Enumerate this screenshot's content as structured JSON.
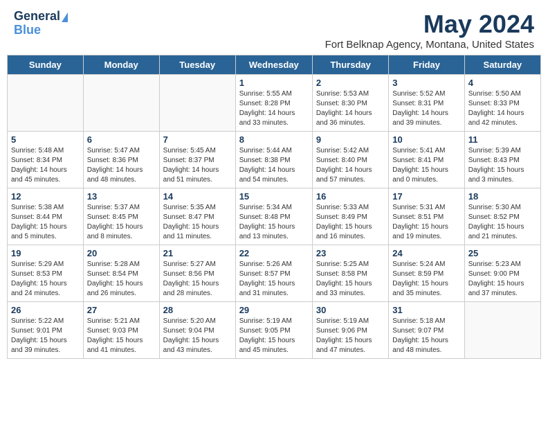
{
  "header": {
    "logo_line1": "General",
    "logo_line2": "Blue",
    "month_title": "May 2024",
    "subtitle": "Fort Belknap Agency, Montana, United States"
  },
  "weekdays": [
    "Sunday",
    "Monday",
    "Tuesday",
    "Wednesday",
    "Thursday",
    "Friday",
    "Saturday"
  ],
  "weeks": [
    [
      {
        "day": "",
        "info": ""
      },
      {
        "day": "",
        "info": ""
      },
      {
        "day": "",
        "info": ""
      },
      {
        "day": "1",
        "info": "Sunrise: 5:55 AM\nSunset: 8:28 PM\nDaylight: 14 hours\nand 33 minutes."
      },
      {
        "day": "2",
        "info": "Sunrise: 5:53 AM\nSunset: 8:30 PM\nDaylight: 14 hours\nand 36 minutes."
      },
      {
        "day": "3",
        "info": "Sunrise: 5:52 AM\nSunset: 8:31 PM\nDaylight: 14 hours\nand 39 minutes."
      },
      {
        "day": "4",
        "info": "Sunrise: 5:50 AM\nSunset: 8:33 PM\nDaylight: 14 hours\nand 42 minutes."
      }
    ],
    [
      {
        "day": "5",
        "info": "Sunrise: 5:48 AM\nSunset: 8:34 PM\nDaylight: 14 hours\nand 45 minutes."
      },
      {
        "day": "6",
        "info": "Sunrise: 5:47 AM\nSunset: 8:36 PM\nDaylight: 14 hours\nand 48 minutes."
      },
      {
        "day": "7",
        "info": "Sunrise: 5:45 AM\nSunset: 8:37 PM\nDaylight: 14 hours\nand 51 minutes."
      },
      {
        "day": "8",
        "info": "Sunrise: 5:44 AM\nSunset: 8:38 PM\nDaylight: 14 hours\nand 54 minutes."
      },
      {
        "day": "9",
        "info": "Sunrise: 5:42 AM\nSunset: 8:40 PM\nDaylight: 14 hours\nand 57 minutes."
      },
      {
        "day": "10",
        "info": "Sunrise: 5:41 AM\nSunset: 8:41 PM\nDaylight: 15 hours\nand 0 minutes."
      },
      {
        "day": "11",
        "info": "Sunrise: 5:39 AM\nSunset: 8:43 PM\nDaylight: 15 hours\nand 3 minutes."
      }
    ],
    [
      {
        "day": "12",
        "info": "Sunrise: 5:38 AM\nSunset: 8:44 PM\nDaylight: 15 hours\nand 5 minutes."
      },
      {
        "day": "13",
        "info": "Sunrise: 5:37 AM\nSunset: 8:45 PM\nDaylight: 15 hours\nand 8 minutes."
      },
      {
        "day": "14",
        "info": "Sunrise: 5:35 AM\nSunset: 8:47 PM\nDaylight: 15 hours\nand 11 minutes."
      },
      {
        "day": "15",
        "info": "Sunrise: 5:34 AM\nSunset: 8:48 PM\nDaylight: 15 hours\nand 13 minutes."
      },
      {
        "day": "16",
        "info": "Sunrise: 5:33 AM\nSunset: 8:49 PM\nDaylight: 15 hours\nand 16 minutes."
      },
      {
        "day": "17",
        "info": "Sunrise: 5:31 AM\nSunset: 8:51 PM\nDaylight: 15 hours\nand 19 minutes."
      },
      {
        "day": "18",
        "info": "Sunrise: 5:30 AM\nSunset: 8:52 PM\nDaylight: 15 hours\nand 21 minutes."
      }
    ],
    [
      {
        "day": "19",
        "info": "Sunrise: 5:29 AM\nSunset: 8:53 PM\nDaylight: 15 hours\nand 24 minutes."
      },
      {
        "day": "20",
        "info": "Sunrise: 5:28 AM\nSunset: 8:54 PM\nDaylight: 15 hours\nand 26 minutes."
      },
      {
        "day": "21",
        "info": "Sunrise: 5:27 AM\nSunset: 8:56 PM\nDaylight: 15 hours\nand 28 minutes."
      },
      {
        "day": "22",
        "info": "Sunrise: 5:26 AM\nSunset: 8:57 PM\nDaylight: 15 hours\nand 31 minutes."
      },
      {
        "day": "23",
        "info": "Sunrise: 5:25 AM\nSunset: 8:58 PM\nDaylight: 15 hours\nand 33 minutes."
      },
      {
        "day": "24",
        "info": "Sunrise: 5:24 AM\nSunset: 8:59 PM\nDaylight: 15 hours\nand 35 minutes."
      },
      {
        "day": "25",
        "info": "Sunrise: 5:23 AM\nSunset: 9:00 PM\nDaylight: 15 hours\nand 37 minutes."
      }
    ],
    [
      {
        "day": "26",
        "info": "Sunrise: 5:22 AM\nSunset: 9:01 PM\nDaylight: 15 hours\nand 39 minutes."
      },
      {
        "day": "27",
        "info": "Sunrise: 5:21 AM\nSunset: 9:03 PM\nDaylight: 15 hours\nand 41 minutes."
      },
      {
        "day": "28",
        "info": "Sunrise: 5:20 AM\nSunset: 9:04 PM\nDaylight: 15 hours\nand 43 minutes."
      },
      {
        "day": "29",
        "info": "Sunrise: 5:19 AM\nSunset: 9:05 PM\nDaylight: 15 hours\nand 45 minutes."
      },
      {
        "day": "30",
        "info": "Sunrise: 5:19 AM\nSunset: 9:06 PM\nDaylight: 15 hours\nand 47 minutes."
      },
      {
        "day": "31",
        "info": "Sunrise: 5:18 AM\nSunset: 9:07 PM\nDaylight: 15 hours\nand 48 minutes."
      },
      {
        "day": "",
        "info": ""
      }
    ]
  ]
}
